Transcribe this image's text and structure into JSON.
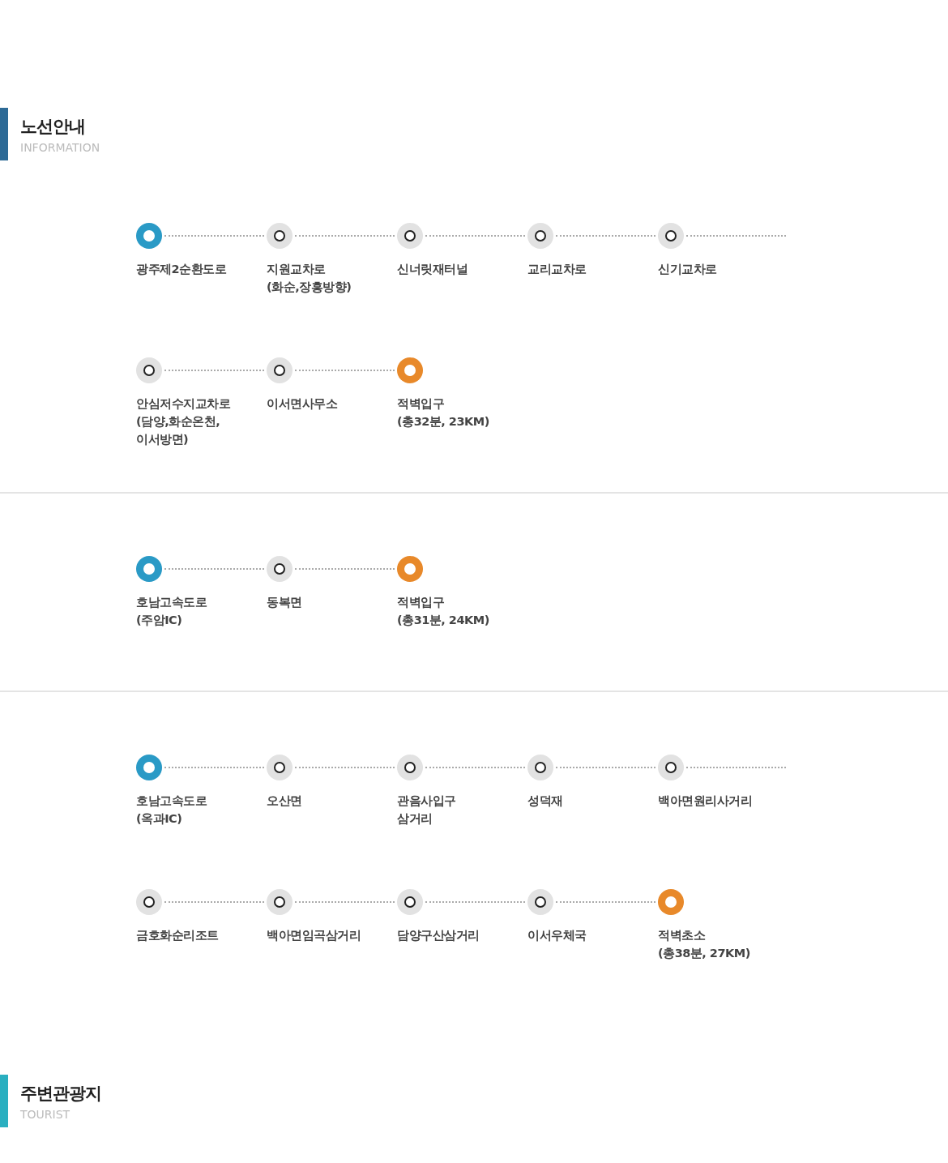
{
  "sections": [
    {
      "title": "노선안내",
      "subtitle": "INFORMATION",
      "color": "#2d6a96",
      "routes": [
        {
          "stops": [
            {
              "label": "광주제2순환도로",
              "kind": "start"
            },
            {
              "label": "지원교차로\n(화순,장흥방향)",
              "kind": "stop"
            },
            {
              "label": "신너릿재터널",
              "kind": "stop"
            },
            {
              "label": "교리교차로",
              "kind": "stop"
            },
            {
              "label": "신기교차로",
              "kind": "stop"
            },
            {
              "label": "안심저수지교차로\n(담양,화순온천,\n이서방면)",
              "kind": "stop"
            },
            {
              "label": "이서면사무소",
              "kind": "stop"
            },
            {
              "label": "적벽입구\n(총32분, 23KM)",
              "kind": "end"
            }
          ]
        },
        {
          "stops": [
            {
              "label": "호남고속도로\n(주암IC)",
              "kind": "start"
            },
            {
              "label": "동복면",
              "kind": "stop"
            },
            {
              "label": "적벽입구\n(총31분, 24KM)",
              "kind": "end"
            }
          ]
        },
        {
          "stops": [
            {
              "label": "호남고속도로\n(옥과IC)",
              "kind": "start"
            },
            {
              "label": "오산면",
              "kind": "stop"
            },
            {
              "label": "관음사입구\n삼거리",
              "kind": "stop"
            },
            {
              "label": "성덕재",
              "kind": "stop"
            },
            {
              "label": "백아면원리사거리",
              "kind": "stop"
            },
            {
              "label": "금호화순리조트",
              "kind": "stop"
            },
            {
              "label": "백아면임곡삼거리",
              "kind": "stop"
            },
            {
              "label": "담양구산삼거리",
              "kind": "stop"
            },
            {
              "label": "이서우체국",
              "kind": "stop"
            },
            {
              "label": "적벽초소\n(총38분, 27KM)",
              "kind": "end"
            }
          ]
        }
      ]
    },
    {
      "title": "주변관광지",
      "subtitle": "TOURIST",
      "color": "#2aafc0"
    }
  ]
}
